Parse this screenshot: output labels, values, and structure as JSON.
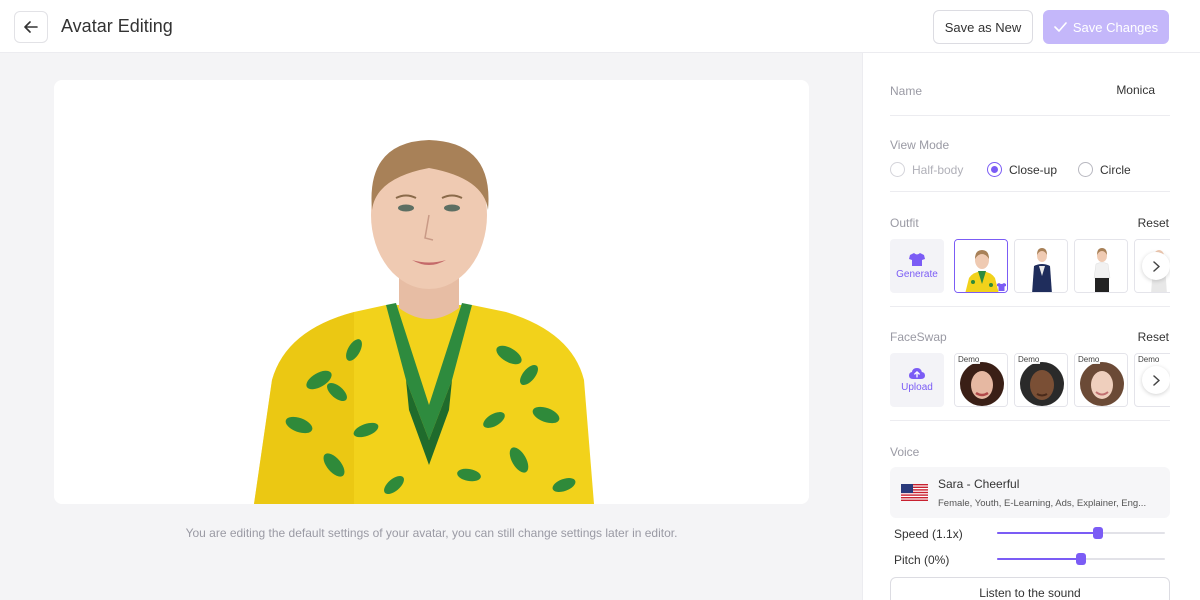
{
  "header": {
    "back_icon": "arrow-left-icon",
    "title": "Avatar Editing",
    "save_as_new_label": "Save as New",
    "save_changes_label": "Save Changes"
  },
  "editor": {
    "hint": "You are editing the default settings of your avatar, you can still change settings later in editor."
  },
  "panel": {
    "name_label": "Name",
    "name_value": "Monica",
    "view_mode": {
      "label": "View Mode",
      "options": [
        {
          "label": "Half-body",
          "state": "disabled"
        },
        {
          "label": "Close-up",
          "state": "checked"
        },
        {
          "label": "Circle",
          "state": "unchecked"
        }
      ]
    },
    "outfit": {
      "label": "Outfit",
      "reset_label": "Reset",
      "generate_label": "Generate",
      "generate_icon": "tshirt-icon",
      "selected_index": 0
    },
    "faceswap": {
      "label": "FaceSwap",
      "reset_label": "Reset",
      "upload_label": "Upload",
      "upload_icon": "cloud-upload-icon",
      "demo_label": "Demo"
    },
    "voice": {
      "label": "Voice",
      "flag_icon": "us-flag-icon",
      "name": "Sara - Cheerful",
      "description": "Female, Youth, E-Learning, Ads, Explainer, Eng..."
    },
    "speed": {
      "label": "Speed (1.1x)",
      "value": 0.6
    },
    "pitch": {
      "label": "Pitch (0%)",
      "value": 0.5
    },
    "listen_label": "Listen to the sound"
  },
  "colors": {
    "accent": "#7b5cf5",
    "accent_light": "#c4b7fa",
    "outfit_yellow": "#f2d21b",
    "outfit_green": "#2e8b3e"
  }
}
